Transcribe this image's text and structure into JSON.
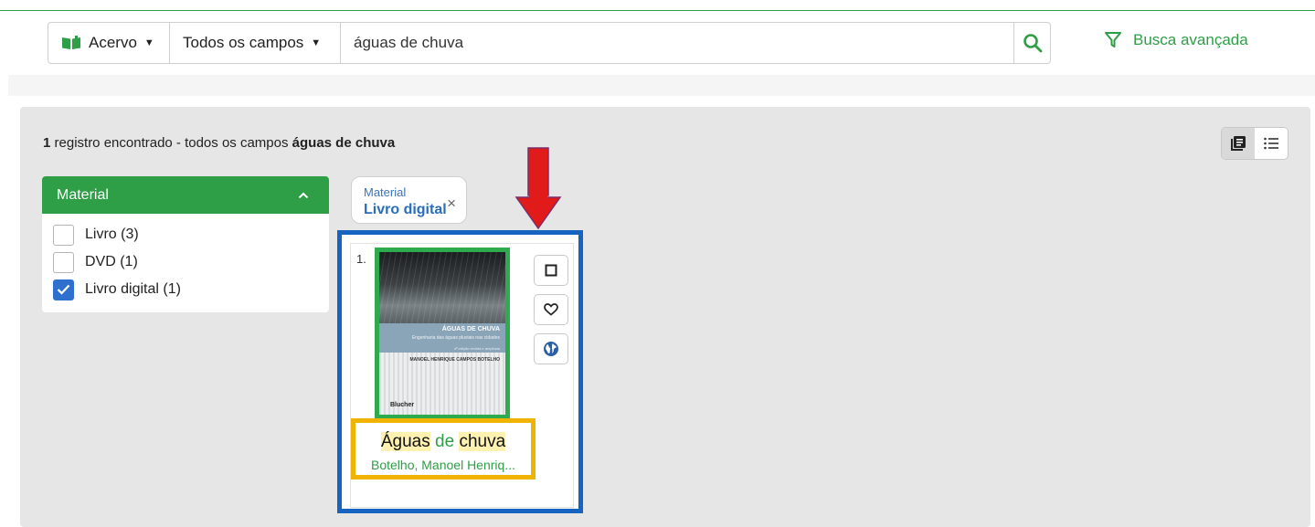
{
  "search": {
    "scope_label": "Acervo",
    "field_label": "Todos os campos",
    "query": "águas de chuva",
    "advanced_label": "Busca avançada"
  },
  "results": {
    "count": "1",
    "summary_text": " registro encontrado - todos os campos ",
    "query_bold": "águas de chuva"
  },
  "facet": {
    "title": "Material",
    "items": [
      {
        "label": "Livro (3)",
        "checked": false
      },
      {
        "label": "DVD (1)",
        "checked": false
      },
      {
        "label": "Livro digital (1)",
        "checked": true
      }
    ]
  },
  "active_filter": {
    "type": "Material",
    "value": "Livro digital"
  },
  "record": {
    "rank": "1.",
    "title_part1": "Águas",
    "title_part2": "de",
    "title_part3": "chuva",
    "author": "Botelho, Manoel Henriq...",
    "cover": {
      "title": "ÁGUAS DE CHUVA",
      "subtitle": "Engenharia das águas pluviais nas cidades",
      "edition": "4ª edição revista e ampliada",
      "author": "MANOEL HENRIQUE CAMPOS BOTELHO",
      "publisher": "Blucher"
    }
  },
  "colors": {
    "brand_green": "#2e9e47",
    "checkbox_blue": "#2f6fce",
    "annotation_blue": "#1565c0",
    "annotation_green": "#2eaa4f",
    "annotation_yellow": "#f0b400",
    "annotation_red": "#e11a1a"
  }
}
